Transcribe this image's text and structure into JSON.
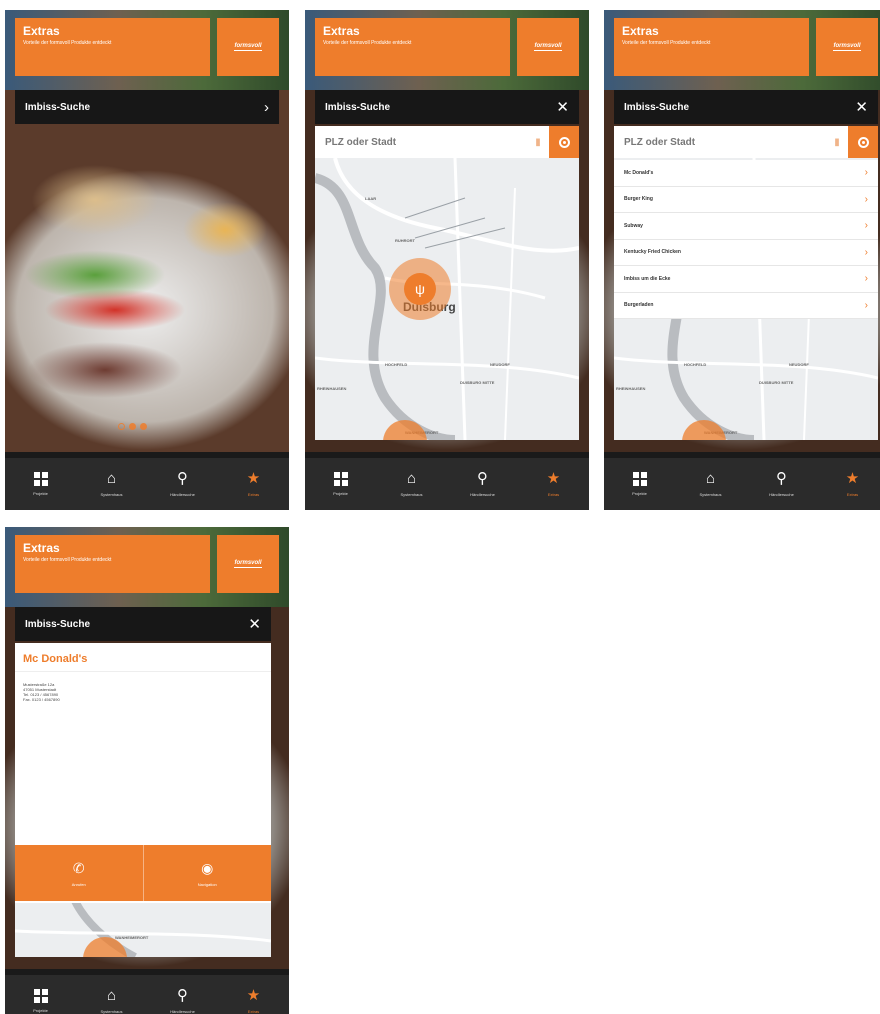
{
  "colors": {
    "accent": "#ee7d2c",
    "dark_header": "#171717",
    "tabbar": "#2b2b2b"
  },
  "header": {
    "title": "Extras",
    "subtitle": "Vorteile der formsvoll Produkte entdeckt",
    "logo_text": "formsvoll"
  },
  "search": {
    "title": "Imbiss-Suche",
    "placeholder": "PLZ oder Stadt",
    "open_icon": "chevron-right-icon",
    "close_icon": "close-icon"
  },
  "map": {
    "city": "Duisburg",
    "labels": [
      "LAAR",
      "RUHRORT",
      "HOCHFELD",
      "NEUDORF",
      "DUISBURG MITTE",
      "RHEINHAUSEN",
      "WANHEIMERORT",
      "DUISSERN"
    ]
  },
  "results": [
    {
      "name": "Mc Donald's"
    },
    {
      "name": "Burger King"
    },
    {
      "name": "Subway"
    },
    {
      "name": "Kentucky Fried Chicken"
    },
    {
      "name": "Imbiss um die Ecke"
    },
    {
      "name": "Burgerladen"
    }
  ],
  "detail": {
    "title": "Mc Donald's",
    "address_lines": [
      "Musterstraße 12a",
      "47051 Musterstadt",
      "Tel. 0123 / 4567890",
      "Fax. 0123 / 4567890"
    ],
    "actions": [
      {
        "label": "Anrufen",
        "icon": "phone-icon"
      },
      {
        "label": "Navigation",
        "icon": "compass-icon"
      }
    ]
  },
  "carousel": {
    "count": 3,
    "active_index": 0
  },
  "tabs": [
    {
      "label": "Projekte",
      "icon": "grid-icon",
      "active": false
    },
    {
      "label": "Systemhaus",
      "icon": "home-icon",
      "active": false
    },
    {
      "label": "Händlersuche",
      "icon": "location-pin-icon",
      "active": false
    },
    {
      "label": "Extras",
      "icon": "star-icon",
      "active": true
    }
  ]
}
